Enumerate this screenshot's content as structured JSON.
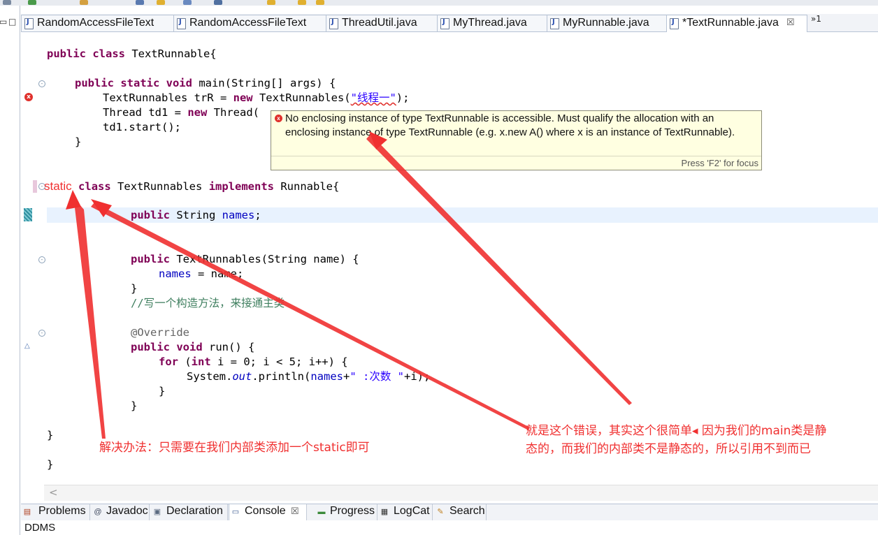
{
  "editor_tabs": [
    {
      "label": "RandomAccessFileText",
      "active": false
    },
    {
      "label": "RandomAccessFileText",
      "active": false
    },
    {
      "label": "ThreadUtil.java",
      "active": false
    },
    {
      "label": "MyThread.java",
      "active": false
    },
    {
      "label": "MyRunnable.java",
      "active": false
    },
    {
      "label": "*TextRunnable.java",
      "active": true
    }
  ],
  "tab_close": "☒",
  "tab_overflow": "»1",
  "code": {
    "l1": {
      "kw": "public class",
      "rest": " TextRunnable{"
    },
    "l2": {
      "kw": "public static void",
      "rest": " main(String[] args) {"
    },
    "l3": {
      "pre": "TextRunnables trR = ",
      "kw": "new",
      "mid": " TextRunnables(",
      "str": "\"线程一\"",
      "post": ");"
    },
    "l4": {
      "pre": "Thread td1 = ",
      "kw": "new",
      "post": " Thread("
    },
    "l5": "td1.start();",
    "l6": "}",
    "l7": {
      "static": "static",
      "kw1": "class",
      "mid": " TextRunnables ",
      "kw2": "implements",
      "post": " Runnable{"
    },
    "l8": {
      "kw": "public",
      "mid": " String ",
      "field": "names",
      "post": ";"
    },
    "l9": {
      "kw": "public",
      "post": " TextRunnables(String name) {"
    },
    "l10": {
      "field": "names",
      "post": " = name;"
    },
    "l11": "}",
    "l12": "//写一个构造方法，来接通主类",
    "l13": "@Override",
    "l14": {
      "kw": "public void",
      "post": " run() {"
    },
    "l15": {
      "kw1": "for",
      "mid1": " (",
      "kw2": "int",
      "post": " i = 0; i < 5; i++) {"
    },
    "l16": {
      "pre": "System.",
      "ital": "out",
      "mid": ".println(",
      "field": "names",
      "plus": "+",
      "str": "\" :次数 \"",
      "post": "+i);"
    },
    "l17": "}",
    "l18": "}",
    "l19": "}",
    "l20": "}"
  },
  "tooltip": {
    "message": "No enclosing instance of type TextRunnable is accessible. Must qualify the allocation with an enclosing instance of type TextRunnable (e.g. x.new A() where x is an instance of TextRunnable).",
    "footer": "Press 'F2' for focus"
  },
  "annotations": {
    "solution": "解决办法：只需要在我们内部类添加一个static即可",
    "explain_line1": "就是这个错误，其实这个很简单◂  因为我们的main类是静",
    "explain_line2": "态的，而我们的内部类不是静态的，所以引用不到而已"
  },
  "bottom_tabs": [
    {
      "label": "Problems",
      "icon": "problems-icon"
    },
    {
      "label": "Javadoc",
      "icon": "javadoc-icon"
    },
    {
      "label": "Declaration",
      "icon": "declaration-icon"
    },
    {
      "label": "Console",
      "icon": "console-icon",
      "active": true
    },
    {
      "label": "Progress",
      "icon": "progress-icon"
    },
    {
      "label": "LogCat",
      "icon": "logcat-icon"
    },
    {
      "label": "Search",
      "icon": "search-icon"
    }
  ],
  "ddms_label": "DDMS",
  "colors": {
    "keyword": "#7f0055",
    "string": "#2a00ff",
    "field": "#0000c0",
    "comment": "#3f7f5f",
    "annotation": "#f03030",
    "tooltip_bg": "#ffffe1"
  }
}
